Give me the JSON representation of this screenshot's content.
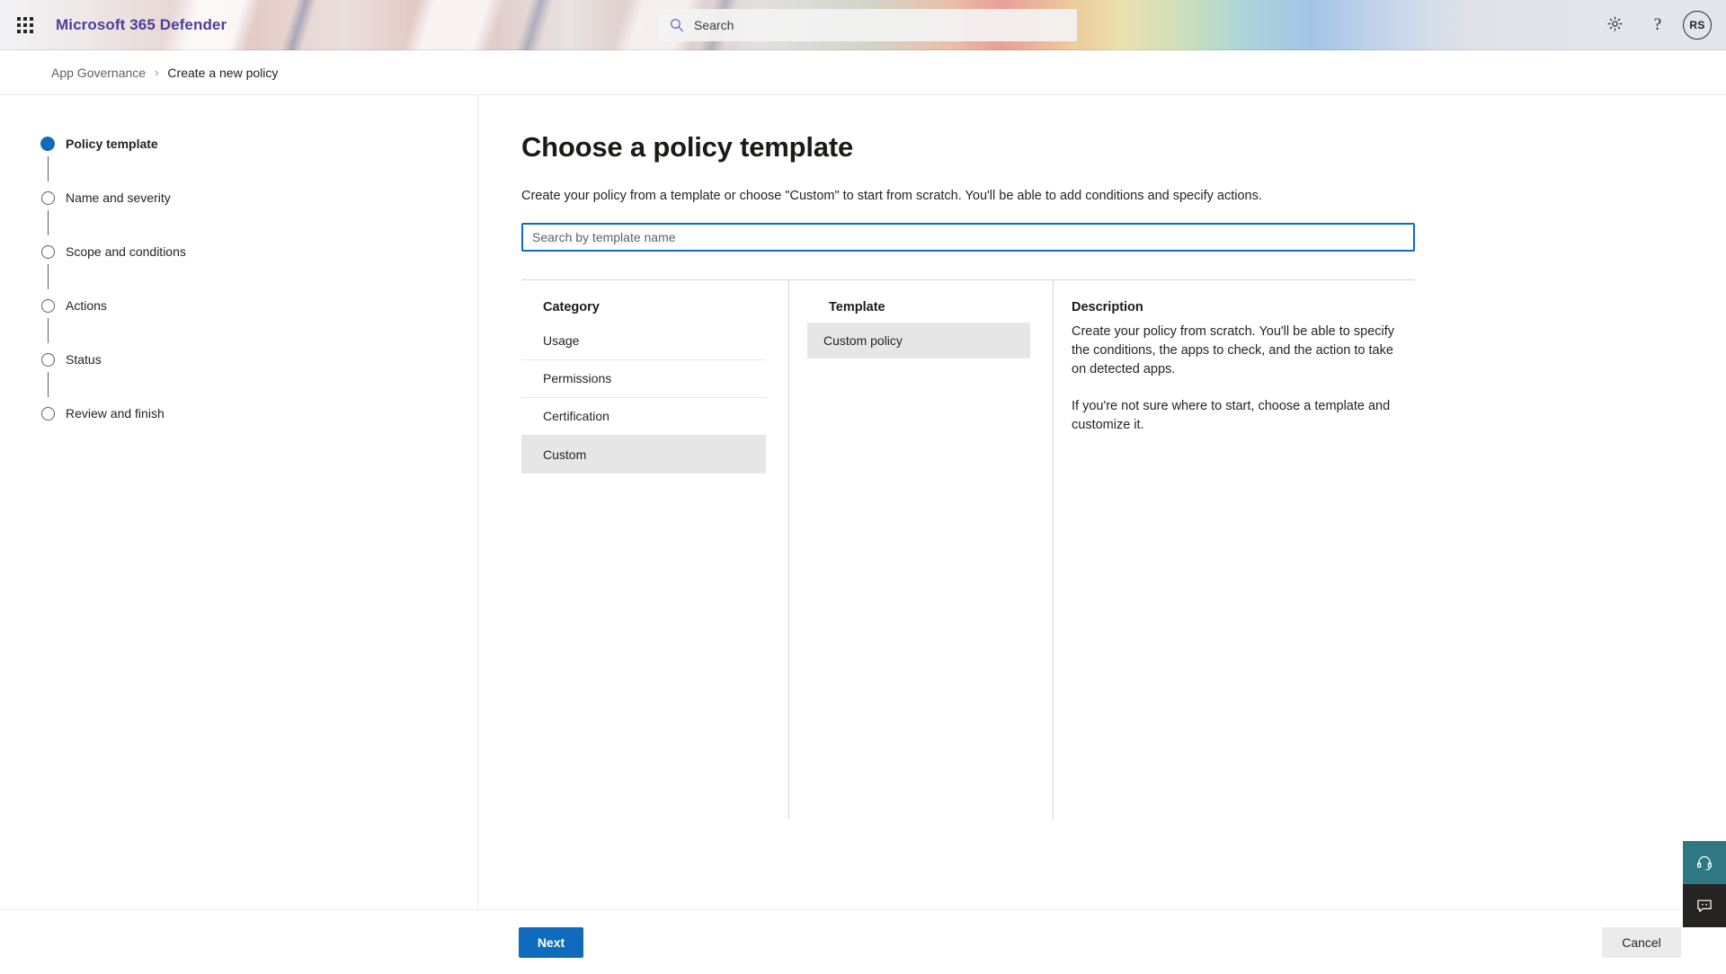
{
  "header": {
    "waffle_icon": "app-launcher-waffle-icon",
    "suite_title": "Microsoft 365 Defender",
    "search": {
      "placeholder": "Search",
      "icon": "search-icon"
    },
    "settings_icon": "gear-icon",
    "help_icon": "question-mark-icon",
    "help_glyph": "?",
    "avatar_initials": "RS",
    "brand_color": "#4b3f9e"
  },
  "breadcrumb": {
    "items": [
      {
        "label": "App Governance",
        "current": false
      },
      {
        "label": "Create a new policy",
        "current": true
      }
    ],
    "separator": "›"
  },
  "wizard": {
    "steps": [
      {
        "label": "Policy template",
        "state": "active"
      },
      {
        "label": "Name and severity",
        "state": "pending"
      },
      {
        "label": "Scope and conditions",
        "state": "pending"
      },
      {
        "label": "Actions",
        "state": "pending"
      },
      {
        "label": "Status",
        "state": "pending"
      },
      {
        "label": "Review and finish",
        "state": "pending"
      }
    ],
    "active_color": "#0f6cbd"
  },
  "main": {
    "title": "Choose a policy template",
    "subtitle": "Create your policy from a template or choose \"Custom\" to start from scratch. You'll be able to add conditions and specify actions.",
    "template_search": {
      "value": "",
      "placeholder": "Search by template name",
      "focused": true,
      "focus_color": "#0f6cbd"
    },
    "category": {
      "heading": "Category",
      "items": [
        {
          "label": "Usage",
          "selected": false
        },
        {
          "label": "Permissions",
          "selected": false
        },
        {
          "label": "Certification",
          "selected": false
        },
        {
          "label": "Custom",
          "selected": true
        }
      ]
    },
    "template": {
      "heading": "Template",
      "items": [
        {
          "label": "Custom policy",
          "selected": true
        }
      ]
    },
    "description": {
      "heading": "Description",
      "paragraphs": [
        "Create your policy from scratch. You'll be able to specify the conditions, the apps to check, and the action to take on detected apps.",
        "If you're not sure where to start, choose a template and customize it."
      ]
    }
  },
  "footer": {
    "next_label": "Next",
    "cancel_label": "Cancel",
    "primary_color": "#0f6cbd"
  },
  "floating": {
    "support": {
      "icon": "headset-icon",
      "color": "#2f7782"
    },
    "feedback": {
      "icon": "feedback-chat-icon",
      "color": "#252423"
    }
  }
}
